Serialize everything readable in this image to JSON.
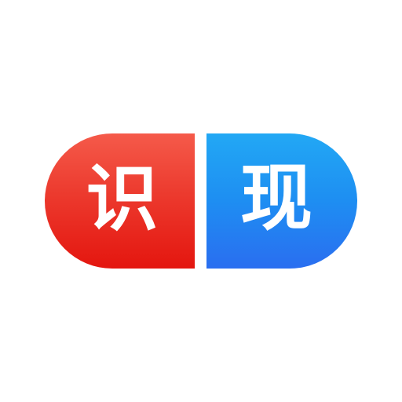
{
  "logo": {
    "left_character": "识",
    "right_character": "现",
    "colors": {
      "background": "#ffffff",
      "left_top": "#f55a4a",
      "left_bottom": "#e4160f",
      "right_top": "#22a8f4",
      "right_bottom": "#2a6ef0",
      "text": "#ffffff"
    }
  }
}
